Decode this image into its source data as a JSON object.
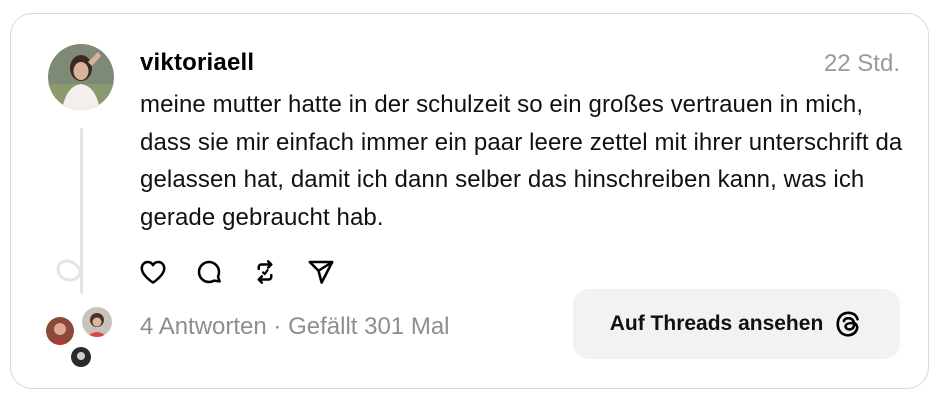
{
  "post": {
    "username": "viktoriaell",
    "timestamp": "22 Std.",
    "text": "meine mutter hatte in der schulzeit so ein großes vertrauen in mich, dass sie mir einfach immer ein paar leere zettel mit ihrer unterschrift da gelassen hat, damit ich dann selber das hinschreiben kann, was ich gerade gebraucht hab."
  },
  "actions": [
    {
      "name": "like",
      "icon": "heart-icon"
    },
    {
      "name": "reply",
      "icon": "comment-icon"
    },
    {
      "name": "repost",
      "icon": "repost-icon"
    },
    {
      "name": "share",
      "icon": "send-icon"
    }
  ],
  "footer": {
    "replies": "4 Antworten",
    "separator": " · ",
    "likes": "Gefällt 301 Mal",
    "open_button_label": "Auf Threads ansehen",
    "open_button_icon": "threads-logo-icon"
  },
  "colors": {
    "border": "#d9d9d9",
    "muted_text": "#8e8e8e",
    "button_bg": "#f2f2f2"
  }
}
